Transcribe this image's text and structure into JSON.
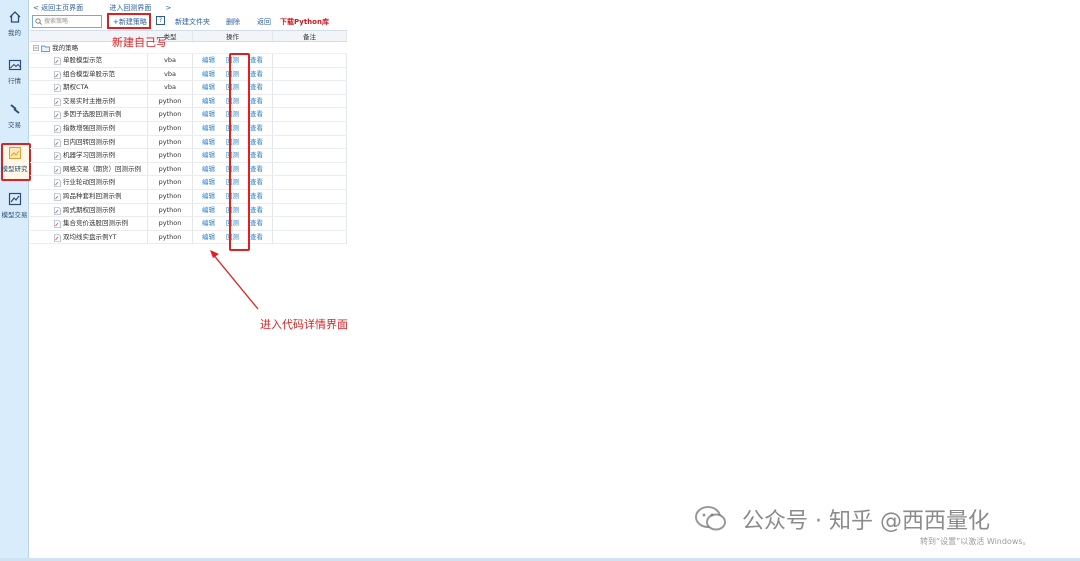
{
  "sidebar": {
    "items": [
      {
        "label": "我的",
        "icon": "home-icon"
      },
      {
        "label": "行情",
        "icon": "image-icon"
      },
      {
        "label": "交易",
        "icon": "lightning-icon"
      },
      {
        "label": "模型研究",
        "icon": "model-research-icon"
      },
      {
        "label": "模型交易",
        "icon": "model-trade-icon"
      }
    ]
  },
  "breadcrumb": {
    "back_home": "返回主页界面",
    "enter_backtest": "进入回测界面"
  },
  "toolbar": {
    "search_placeholder": "搜索策略",
    "new_strategy": "+新建策略",
    "help": "?",
    "new_folder": "新建文件夹",
    "delete": "删除",
    "back": "返回",
    "download_python": "下载Python库"
  },
  "table": {
    "headers": {
      "name": "",
      "type": "类型",
      "ops": "操作",
      "note": "备注"
    },
    "group": "我的策略",
    "op_labels": {
      "edit": "编辑",
      "backtest": "回测",
      "view": "查看"
    },
    "rows": [
      {
        "name": "单股模型示范",
        "type": "vba"
      },
      {
        "name": "组合模型单股示范",
        "type": "vba"
      },
      {
        "name": "期权CTA",
        "type": "vba"
      },
      {
        "name": "交易实时主推示例",
        "type": "python"
      },
      {
        "name": "多因子选股回测示例",
        "type": "python"
      },
      {
        "name": "指数增强回测示例",
        "type": "python"
      },
      {
        "name": "日内回转回测示例",
        "type": "python"
      },
      {
        "name": "机器学习回测示例",
        "type": "python"
      },
      {
        "name": "网格交易（期货）回测示例",
        "type": "python"
      },
      {
        "name": "行业轮动回测示例",
        "type": "python"
      },
      {
        "name": "跨品种套利回测示例",
        "type": "python"
      },
      {
        "name": "跨式期权回测示例",
        "type": "python"
      },
      {
        "name": "集合竞价选股回测示例",
        "type": "python"
      },
      {
        "name": "双均线实盘示例YT",
        "type": "python"
      }
    ]
  },
  "annotations": {
    "new_own": "新建自己写",
    "enter_code": "进入代码详情界面"
  },
  "watermark": {
    "main": "公众号 · 知乎 @西西量化",
    "sub": "转到“设置”以激活 Windows。"
  },
  "colors": {
    "accent": "#2a7fc9",
    "annotation": "#e02020",
    "sidebar_bg": "#d9ecfb"
  }
}
